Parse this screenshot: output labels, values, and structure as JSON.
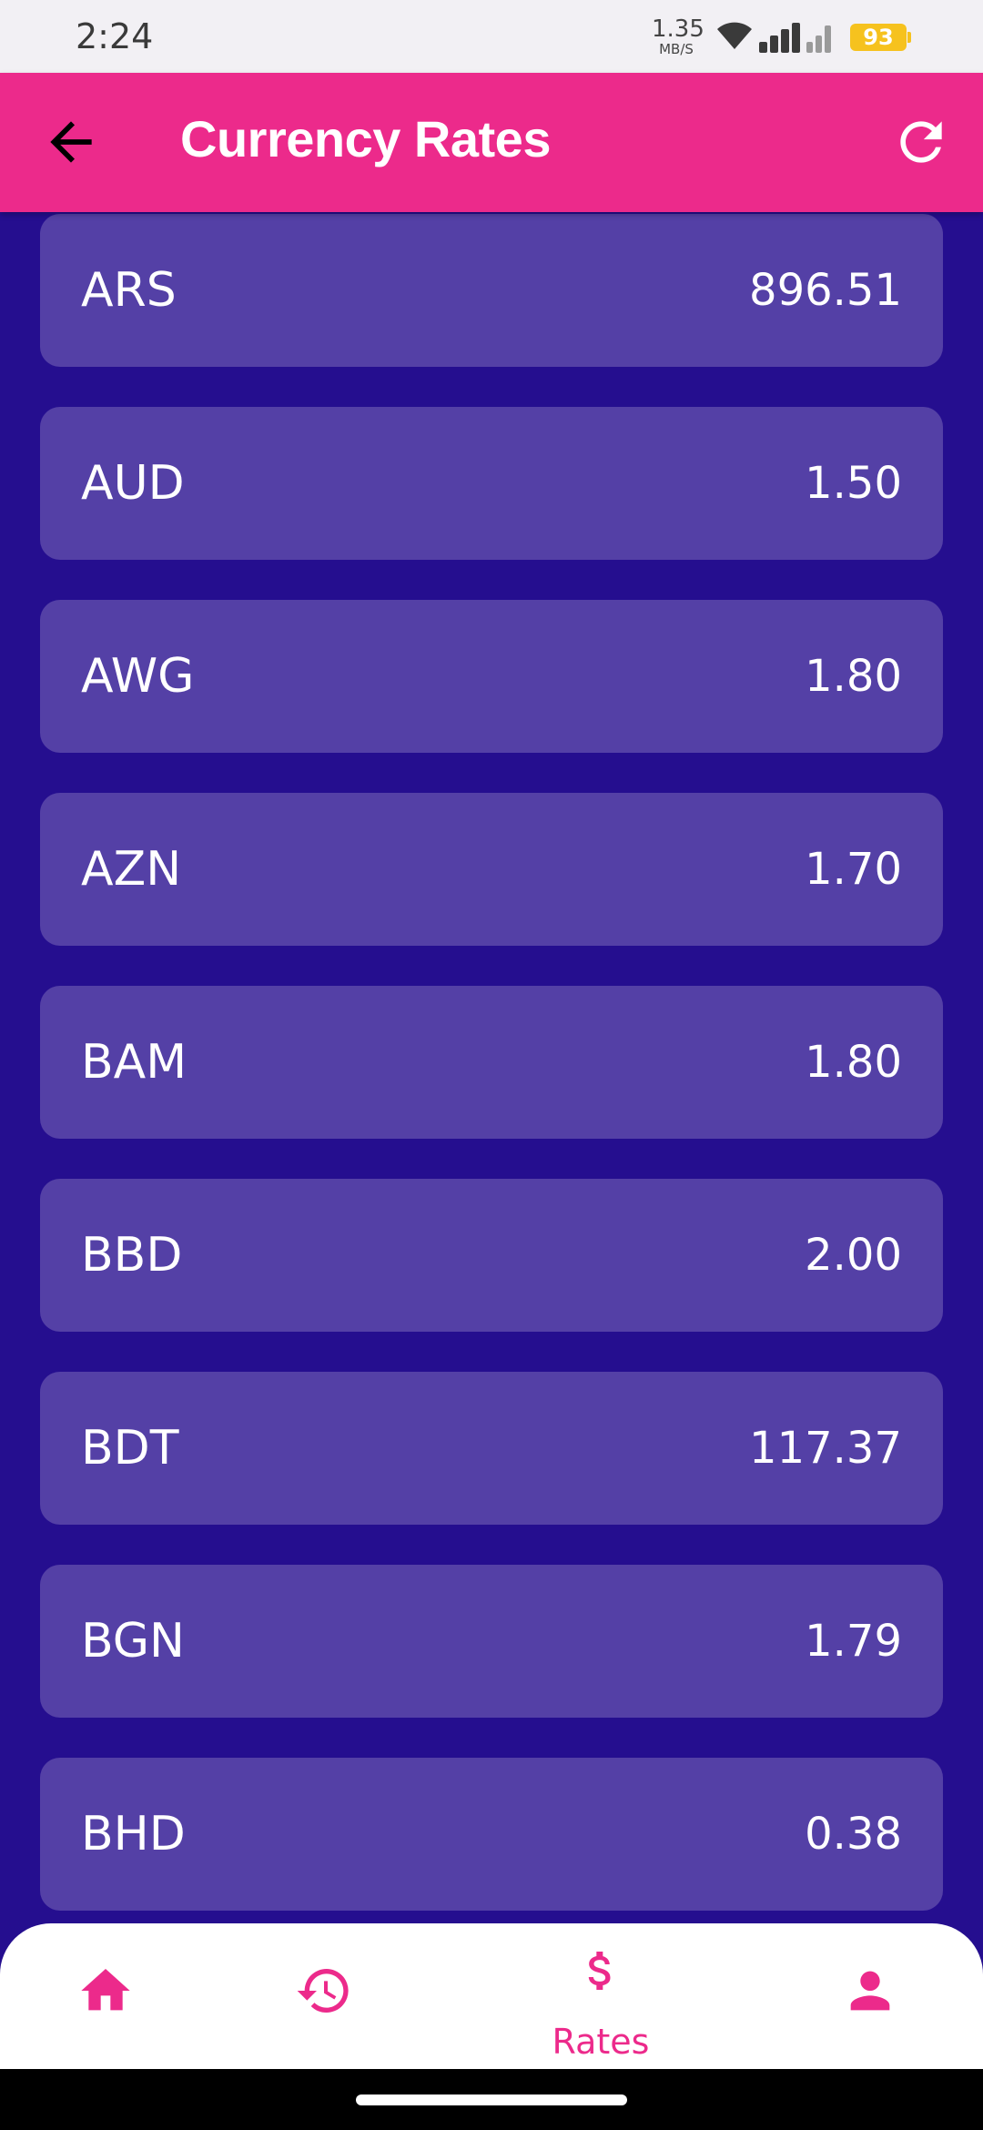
{
  "status_bar": {
    "time": "2:24",
    "network_speed": "1.35",
    "network_speed_unit": "MB/S",
    "battery": "93"
  },
  "app_bar": {
    "title": "Currency Rates",
    "back_icon": "arrow-back-icon",
    "refresh_icon": "refresh-icon",
    "color": "#EC2A8B"
  },
  "theme": {
    "background": "#250E8F",
    "card": "#5440A6",
    "accent": "#EC2A8B"
  },
  "rates": [
    {
      "code": "ARS",
      "value": "896.51"
    },
    {
      "code": "AUD",
      "value": "1.50"
    },
    {
      "code": "AWG",
      "value": "1.80"
    },
    {
      "code": "AZN",
      "value": "1.70"
    },
    {
      "code": "BAM",
      "value": "1.80"
    },
    {
      "code": "BBD",
      "value": "2.00"
    },
    {
      "code": "BDT",
      "value": "117.37"
    },
    {
      "code": "BGN",
      "value": "1.79"
    },
    {
      "code": "BHD",
      "value": "0.38"
    }
  ],
  "bottom_nav": {
    "items": [
      {
        "icon": "home-icon",
        "label": ""
      },
      {
        "icon": "history-icon",
        "label": ""
      },
      {
        "icon": "dollar-icon",
        "label": "Rates"
      },
      {
        "icon": "person-icon",
        "label": ""
      }
    ],
    "active": "Rates"
  }
}
